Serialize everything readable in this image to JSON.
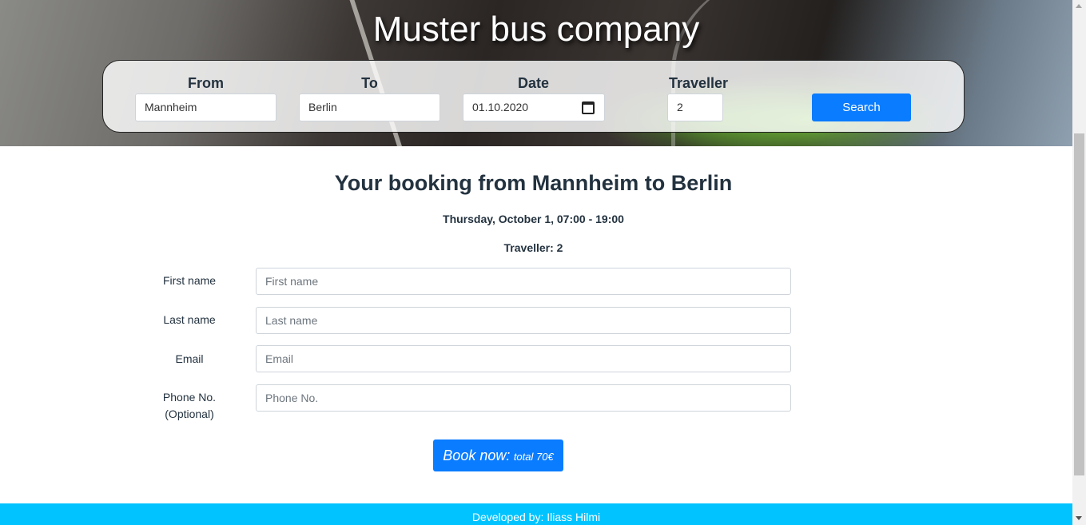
{
  "header": {
    "title": "Muster bus company"
  },
  "search": {
    "from_label": "From",
    "from_value": "Mannheim",
    "to_label": "To",
    "to_value": "Berlin",
    "date_label": "Date",
    "date_value": "01.10.2020",
    "traveller_label": "Traveller",
    "traveller_value": "2",
    "search_label": "Search"
  },
  "booking": {
    "title": "Your booking from Mannheim to Berlin",
    "date_time": "Thursday, October 1, 07:00 - 19:00",
    "traveller": "Traveller: 2"
  },
  "form": {
    "first_name_label": "First name",
    "first_name_placeholder": "First name",
    "last_name_label": "Last name",
    "last_name_placeholder": "Last name",
    "email_label": "Email",
    "email_placeholder": "Email",
    "phone_label": "Phone No.",
    "phone_optional": "(Optional)",
    "phone_placeholder": "Phone No."
  },
  "book_button": {
    "label": "Book now:",
    "total": "total 70€"
  },
  "footer": {
    "text": "Developed by: Iliass Hilmi"
  },
  "colors": {
    "primary": "#0a7cff",
    "footer": "#00c3ff",
    "heading": "#23323f"
  }
}
